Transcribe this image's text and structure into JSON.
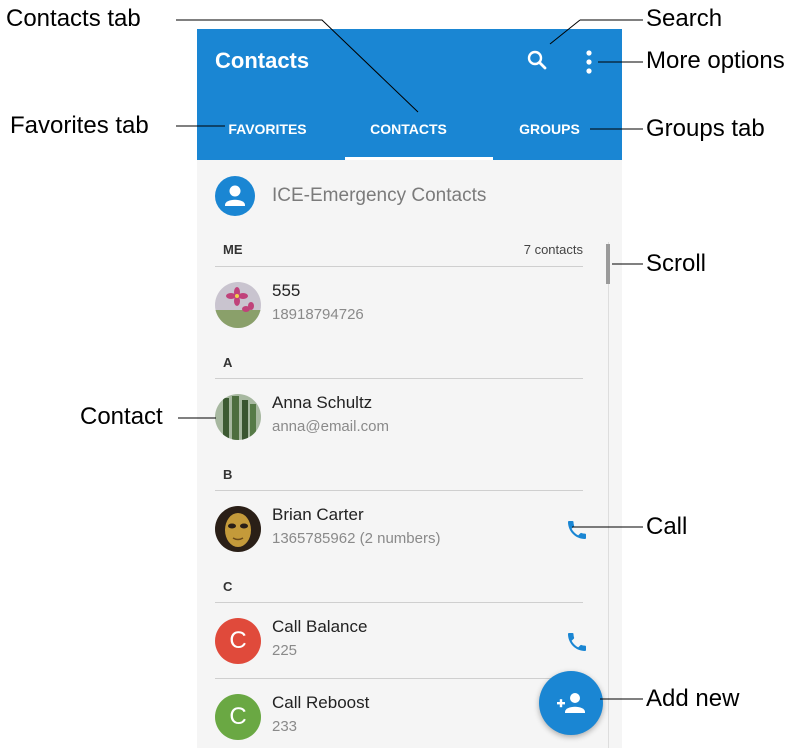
{
  "appbar": {
    "title": "Contacts",
    "search_icon": "search-icon",
    "more_icon": "more-vert-icon"
  },
  "tabs": [
    {
      "label": "FAVORITES",
      "selected": false
    },
    {
      "label": "CONTACTS",
      "selected": true
    },
    {
      "label": "GROUPS",
      "selected": false
    }
  ],
  "ice": {
    "label": "ICE-Emergency Contacts",
    "icon": "person-icon"
  },
  "sections": [
    {
      "letter": "ME",
      "count": "7 contacts"
    },
    {
      "letter": "A"
    },
    {
      "letter": "B"
    },
    {
      "letter": "C"
    }
  ],
  "contacts": [
    {
      "name": "555",
      "detail": "18918794726",
      "avatar": "flower-photo"
    },
    {
      "name": "Anna Schultz",
      "detail": "anna@email.com",
      "avatar": "cactus-photo"
    },
    {
      "name": "Brian Carter",
      "detail": "1365785962 (2 numbers)",
      "avatar": "mask-photo",
      "call_icon": "phone-icon"
    },
    {
      "name": "Call Balance",
      "detail": "225",
      "avatar_letter": "C",
      "avatar_color": "#e04a3b",
      "call_icon": "phone-icon"
    },
    {
      "name": "Call Reboost",
      "detail": "233",
      "avatar_letter": "C",
      "avatar_color": "#6aa843"
    }
  ],
  "fab": {
    "icon": "add-person-icon"
  },
  "callouts": {
    "contacts_tab": "Contacts tab",
    "search": "Search",
    "more_options": "More options",
    "favorites_tab": "Favorites tab",
    "groups_tab": "Groups tab",
    "scroll": "Scroll",
    "contact": "Contact",
    "call": "Call",
    "add_new": "Add new"
  },
  "colors": {
    "accent": "#1a86d3",
    "background": "#f5f5f5",
    "avatar_red": "#e04a3b",
    "avatar_green": "#6aa843"
  }
}
